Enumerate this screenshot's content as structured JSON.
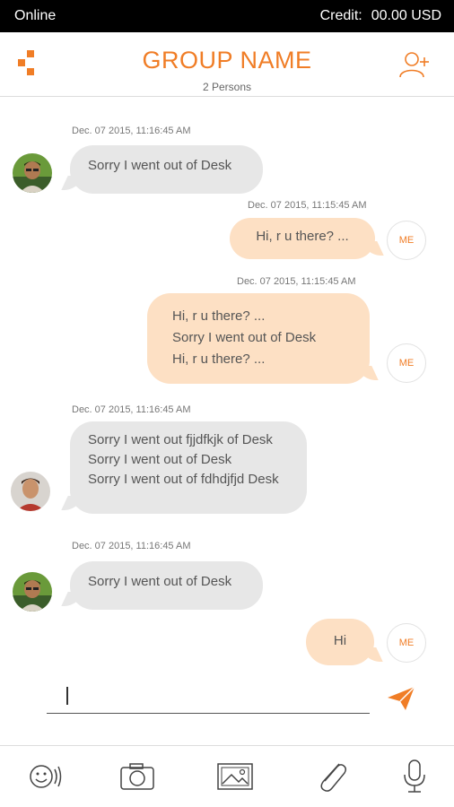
{
  "status_bar": {
    "connection": "Online",
    "credit_label": "Credit:",
    "credit_value": "00.00 USD"
  },
  "header": {
    "title": "GROUP NAME",
    "subtitle": "2 Persons"
  },
  "messages": [
    {
      "direction": "in",
      "timestamp": "Dec. 07 2015, 11:16:45 AM",
      "lines": [
        "Sorry I went out of Desk"
      ]
    },
    {
      "direction": "out",
      "timestamp": "Dec. 07 2015, 11:15:45 AM",
      "lines": [
        "Hi, r u there? ..."
      ],
      "avatar_label": "ME"
    },
    {
      "direction": "out",
      "timestamp": "Dec. 07 2015, 11:15:45 AM",
      "lines": [
        "Hi, r u there? ...",
        "Sorry I went out of Desk",
        "Hi, r u there? ..."
      ],
      "avatar_label": "ME"
    },
    {
      "direction": "in",
      "timestamp": "Dec. 07 2015, 11:16:45 AM",
      "lines": [
        "Sorry I went out fjjdfkjk of Desk",
        "Sorry I went out of Desk",
        "Sorry I went out of fdhdjfjd  Desk"
      ]
    },
    {
      "direction": "in",
      "timestamp": "Dec. 07 2015, 11:16:45 AM",
      "lines": [
        "Sorry I went out of Desk"
      ]
    },
    {
      "direction": "out",
      "timestamp": "",
      "lines": [
        "Hi"
      ],
      "avatar_label": "ME"
    }
  ],
  "compose": {
    "value": "",
    "placeholder": ""
  },
  "toolbar": {
    "icons": [
      "emoji-icon",
      "camera-icon",
      "image-icon",
      "attachment-icon",
      "microphone-icon"
    ]
  },
  "colors": {
    "accent": "#f07d26",
    "outgoing_bubble": "#fde0c4",
    "incoming_bubble": "#e7e7e7",
    "status_bar": "#000000"
  }
}
